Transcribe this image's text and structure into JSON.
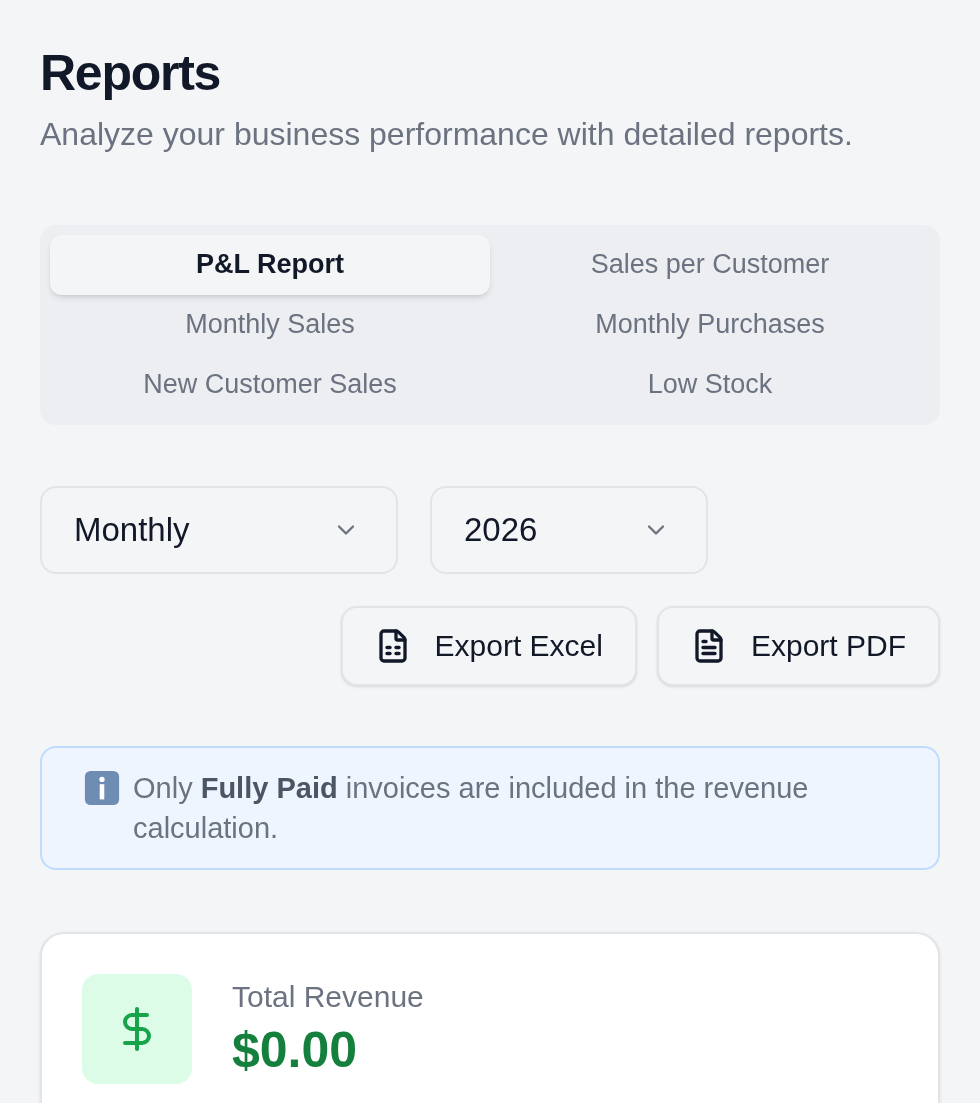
{
  "page": {
    "title": "Reports",
    "subtitle": "Analyze your business performance with detailed reports."
  },
  "tabs": [
    {
      "label": "P&L Report",
      "selected": true
    },
    {
      "label": "Sales per Customer",
      "selected": false
    },
    {
      "label": "Monthly Sales",
      "selected": false
    },
    {
      "label": "Monthly Purchases",
      "selected": false
    },
    {
      "label": "New Customer Sales",
      "selected": false
    },
    {
      "label": "Low Stock",
      "selected": false
    }
  ],
  "filters": [
    {
      "value": "Monthly"
    },
    {
      "value": "2026"
    }
  ],
  "actions": [
    {
      "label": "Export Excel",
      "kind": "excel"
    },
    {
      "label": "Export PDF",
      "kind": "pdf"
    }
  ],
  "notice": {
    "text": "Only **Fully Paid** invoices are included in the revenue calculation."
  },
  "summary_card": {
    "label": "Total Revenue",
    "value": "$0.00"
  }
}
